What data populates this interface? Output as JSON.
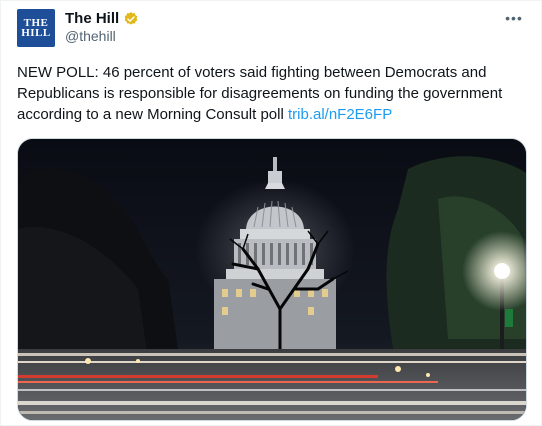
{
  "account": {
    "display_name": "The Hill",
    "handle": "@thehill",
    "avatar_text_line1": "THE",
    "avatar_text_line2": "HILL",
    "verified_badge_color": "#e2b719"
  },
  "tweet": {
    "text": "NEW POLL: 46 percent of voters said fighting between Democrats and Republicans is responsible for disagreements on funding the government according to a new Morning Consult poll ",
    "link_text": "trib.al/nF2E6FP",
    "link_color": "#1d9bf0"
  },
  "menu": {
    "more_icon": "ellipsis-icon",
    "more_label": "•••"
  },
  "media": {
    "icon": "capitol-building-night-photo"
  }
}
